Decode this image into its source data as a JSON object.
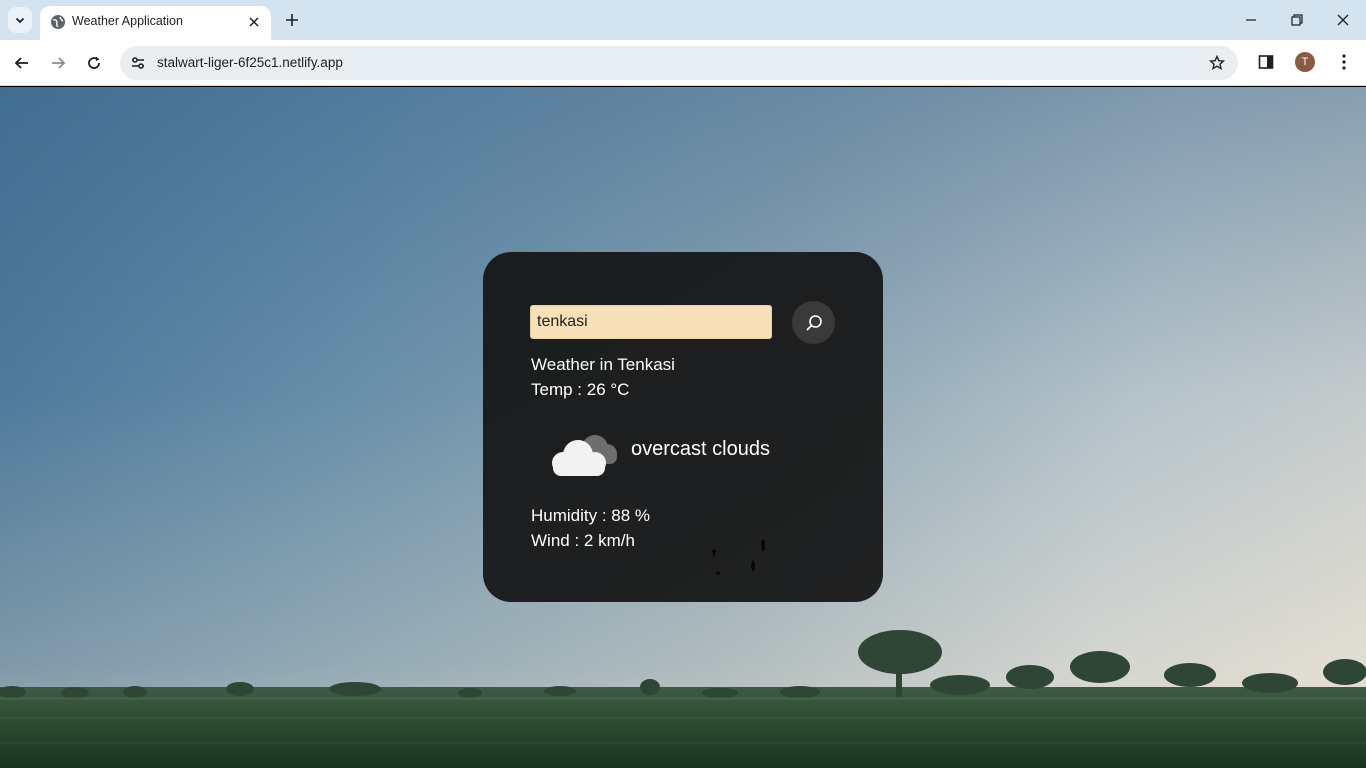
{
  "browser": {
    "tab_title": "Weather Application",
    "url": "stalwart-liger-6f25c1.netlify.app",
    "profile_initial": "T"
  },
  "weather": {
    "search_value": "tenkasi",
    "heading": "Weather in Tenkasi",
    "temp": "Temp : 26 °C",
    "description": "overcast clouds",
    "humidity": "Humidity : 88 %",
    "wind": "Wind : 2 km/h",
    "icon": "overcast-clouds-icon"
  },
  "colors": {
    "card_bg": "#141414",
    "input_bg": "#f7dfb8",
    "search_button_bg": "#3a3a3a"
  }
}
